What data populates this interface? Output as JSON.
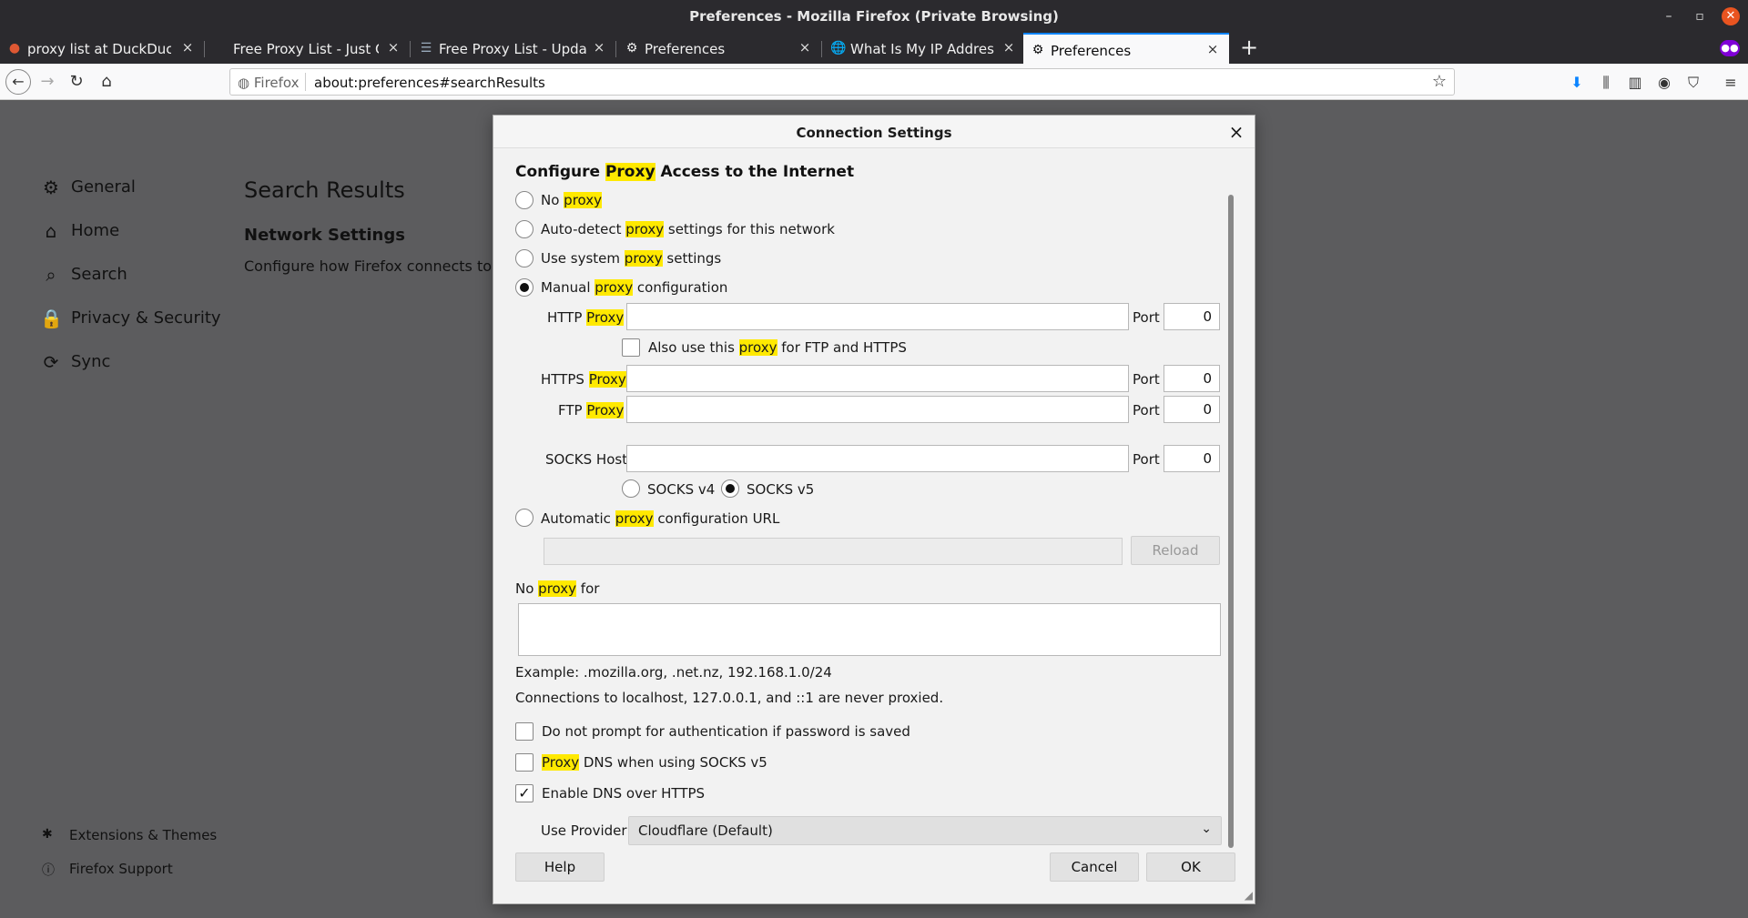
{
  "window": {
    "title": "Preferences - Mozilla Firefox (Private Browsing)"
  },
  "tabs": [
    {
      "title": "proxy list at DuckDuckGo",
      "icon": "duckduckgo-icon"
    },
    {
      "title": "Free Proxy List - Just Che",
      "icon": ""
    },
    {
      "title": "Free Proxy List - Updated",
      "icon": "list-icon"
    },
    {
      "title": "Preferences",
      "icon": "gear-icon"
    },
    {
      "title": "What Is My IP Address - S",
      "icon": "globe-icon"
    },
    {
      "title": "Preferences",
      "icon": "gear-icon"
    }
  ],
  "navbar": {
    "identity": "Firefox",
    "url": "about:preferences#searchResults"
  },
  "sidebar": {
    "items": [
      {
        "label": "General",
        "icon": "gear-icon"
      },
      {
        "label": "Home",
        "icon": "home-icon"
      },
      {
        "label": "Search",
        "icon": "search-icon"
      },
      {
        "label": "Privacy & Security",
        "icon": "lock-icon"
      },
      {
        "label": "Sync",
        "icon": "sync-icon"
      }
    ],
    "footer": [
      {
        "label": "Extensions & Themes",
        "icon": "puzzle-icon"
      },
      {
        "label": "Firefox Support",
        "icon": "help-icon"
      }
    ]
  },
  "content": {
    "title": "Search Results",
    "section_heading": "Network Settings",
    "section_desc": "Configure how Firefox connects to the internet."
  },
  "dialog": {
    "title": "Connection Settings",
    "heading": {
      "pre": "Configure ",
      "hl": "Proxy",
      "post": " Access to the Internet"
    },
    "options": {
      "no_proxy": {
        "pre": "No ",
        "hl": "proxy",
        "post": ""
      },
      "auto_detect": {
        "pre": "Auto-detect ",
        "hl": "proxy",
        "post": " settings for this network"
      },
      "system": {
        "pre": "Use system ",
        "hl": "proxy",
        "post": " settings"
      },
      "manual": {
        "pre": "Manual ",
        "hl": "proxy",
        "post": " configuration"
      },
      "auto_url": {
        "pre": "Automatic ",
        "hl": "proxy",
        "post": " configuration URL"
      }
    },
    "selected": "manual",
    "http": {
      "pre": "HTTP ",
      "hl": "Proxy",
      "value": "",
      "port": "0"
    },
    "also_use": {
      "pre": "Also use this ",
      "hl": "proxy",
      "post": " for FTP and HTTPS",
      "checked": false
    },
    "https": {
      "pre": "HTTPS ",
      "hl": "Proxy",
      "value": "",
      "port": "0"
    },
    "ftp": {
      "pre": "FTP ",
      "hl": "Proxy",
      "value": "",
      "port": "0"
    },
    "socks": {
      "label": "SOCKS Host",
      "value": "",
      "port": "0",
      "v4": "SOCKS v4",
      "v5": "SOCKS v5",
      "version": "v5"
    },
    "port_label": "Port",
    "reload": "Reload",
    "no_proxy_for": {
      "pre": "No ",
      "hl": "proxy",
      "post": " for",
      "value": ""
    },
    "example": "Example: .mozilla.org, .net.nz, 192.168.1.0/24",
    "localhost_note": "Connections to localhost, 127.0.0.1, and ::1 are never proxied.",
    "no_prompt": {
      "label": "Do not prompt for authentication if password is saved",
      "checked": false
    },
    "proxy_dns": {
      "hl": "Proxy",
      "post": " DNS when using SOCKS v5",
      "checked": false
    },
    "dns_https": {
      "label": "Enable DNS over HTTPS",
      "checked": true
    },
    "provider": {
      "label": "Use Provider",
      "value": "Cloudflare (Default)"
    },
    "buttons": {
      "help": "Help",
      "cancel": "Cancel",
      "ok": "OK"
    }
  }
}
